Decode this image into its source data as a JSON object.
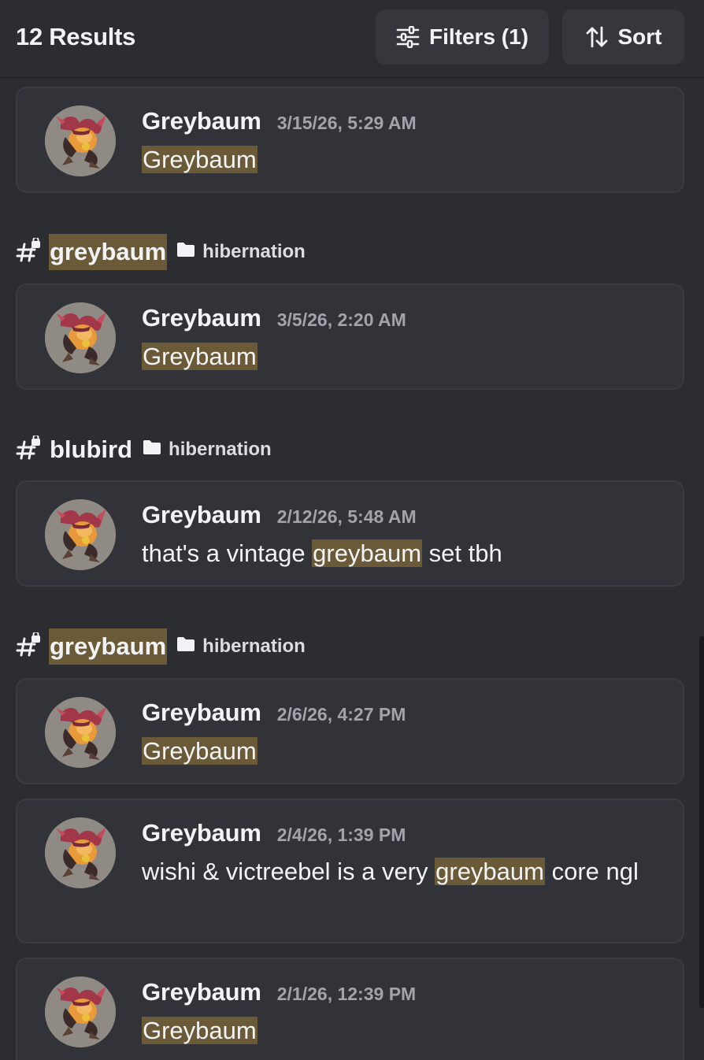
{
  "header": {
    "results_label": "12 Results",
    "filters_label": "Filters (1)",
    "sort_label": "Sort"
  },
  "groups": [
    {
      "channel": null,
      "messages": [
        {
          "author": "Greybaum",
          "timestamp": "3/15/26, 5:29 AM",
          "pre": "",
          "match": "Greybaum",
          "post": ""
        }
      ]
    },
    {
      "channel": {
        "name": "greybaum",
        "highlighted": true,
        "category": "hibernation"
      },
      "messages": [
        {
          "author": "Greybaum",
          "timestamp": "3/5/26, 2:20 AM",
          "pre": "",
          "match": "Greybaum",
          "post": ""
        }
      ]
    },
    {
      "channel": {
        "name": "blubird",
        "highlighted": false,
        "category": "hibernation"
      },
      "messages": [
        {
          "author": "Greybaum",
          "timestamp": "2/12/26, 5:48 AM",
          "pre": "that's a vintage ",
          "match": "greybaum",
          "post": " set tbh"
        }
      ]
    },
    {
      "channel": {
        "name": "greybaum",
        "highlighted": true,
        "category": "hibernation"
      },
      "messages": [
        {
          "author": "Greybaum",
          "timestamp": "2/6/26, 4:27 PM",
          "pre": "",
          "match": "Greybaum",
          "post": ""
        },
        {
          "author": "Greybaum",
          "timestamp": "2/4/26, 1:39 PM",
          "pre": "wishi & victreebel is a very ",
          "match": "greybaum",
          "post": " core ngl"
        },
        {
          "author": "Greybaum",
          "timestamp": "2/1/26, 12:39 PM",
          "pre": "",
          "match": "Greybaum",
          "post": ""
        }
      ]
    }
  ],
  "colors": {
    "background": "#2b2d31",
    "card": "#313338",
    "highlight": "#6a5a37",
    "timestamp": "#a1a4aa"
  },
  "icons": {
    "filters": "sliders-icon",
    "sort": "sort-arrows-icon",
    "channel": "locked-hash-icon",
    "category": "folder-icon"
  }
}
